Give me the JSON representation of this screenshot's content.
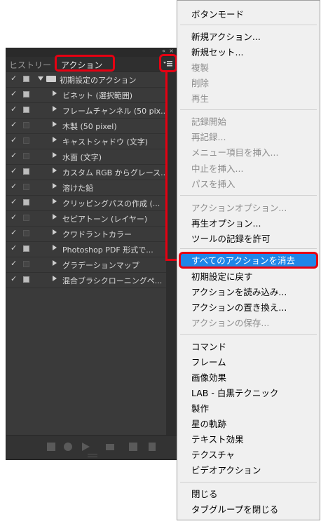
{
  "panel": {
    "collapse_glyph": "«",
    "close_glyph": "×",
    "tabs": {
      "history": "ヒストリー",
      "actions": "アクション"
    },
    "actions": [
      {
        "label": "初期設定のアクション",
        "type": "set",
        "expanded": true,
        "dialog": true
      },
      {
        "label": "ビネット (選択範囲)",
        "dialog": true
      },
      {
        "label": "フレームチャンネル (50 pix...",
        "dialog": true
      },
      {
        "label": "木製 (50 pixel)",
        "dialog": false
      },
      {
        "label": "キャストシャドウ (文字)",
        "dialog": false
      },
      {
        "label": "水面 (文字)",
        "dialog": false
      },
      {
        "label": "カスタム RGB からグレース...",
        "dialog": true
      },
      {
        "label": "溶けた鉛",
        "dialog": false
      },
      {
        "label": "クリッピングパスの作成 (...",
        "dialog": true
      },
      {
        "label": "セピアトーン (レイヤー)",
        "dialog": false
      },
      {
        "label": "クワドラントカラー",
        "dialog": false
      },
      {
        "label": "Photoshop PDF 形式で...",
        "dialog": true
      },
      {
        "label": "グラデーションマップ",
        "dialog": false
      },
      {
        "label": "混合ブラシクローニングペ...",
        "dialog": true
      }
    ],
    "bottom_buttons": [
      "stop-icon",
      "record-icon",
      "play-icon",
      "new-set-icon",
      "new-action-icon",
      "trash-icon"
    ]
  },
  "highlight_color": "#e60012",
  "menu": {
    "items": [
      {
        "label": "ボタンモード",
        "enabled": true
      },
      {
        "label": "新規アクション...",
        "enabled": true
      },
      {
        "label": "新規セット...",
        "enabled": true
      },
      {
        "label": "複製",
        "enabled": false
      },
      {
        "label": "削除",
        "enabled": false
      },
      {
        "label": "再生",
        "enabled": false
      },
      {
        "label": "記録開始",
        "enabled": false
      },
      {
        "label": "再記録...",
        "enabled": false
      },
      {
        "label": "メニュー項目を挿入...",
        "enabled": false
      },
      {
        "label": "中止を挿入...",
        "enabled": false
      },
      {
        "label": "パスを挿入",
        "enabled": false
      },
      {
        "label": "アクションオプション...",
        "enabled": false
      },
      {
        "label": "再生オプション...",
        "enabled": true
      },
      {
        "label": "ツールの記録を許可",
        "enabled": true
      },
      {
        "label": "すべてのアクションを消去",
        "enabled": true,
        "selected": true
      },
      {
        "label": "初期設定に戻す",
        "enabled": true
      },
      {
        "label": "アクションを読み込み...",
        "enabled": true
      },
      {
        "label": "アクションの置き換え...",
        "enabled": true
      },
      {
        "label": "アクションの保存...",
        "enabled": false
      },
      {
        "label": "コマンド",
        "enabled": true
      },
      {
        "label": "フレーム",
        "enabled": true
      },
      {
        "label": "画像効果",
        "enabled": true
      },
      {
        "label": "LAB - 白黒テクニック",
        "enabled": true
      },
      {
        "label": "製作",
        "enabled": true
      },
      {
        "label": "星の軌跡",
        "enabled": true
      },
      {
        "label": "テキスト効果",
        "enabled": true
      },
      {
        "label": "テクスチャ",
        "enabled": true
      },
      {
        "label": "ビデオアクション",
        "enabled": true
      },
      {
        "label": "閉じる",
        "enabled": true
      },
      {
        "label": "タブグループを閉じる",
        "enabled": true
      }
    ],
    "selected_color": "#1f86e8"
  }
}
